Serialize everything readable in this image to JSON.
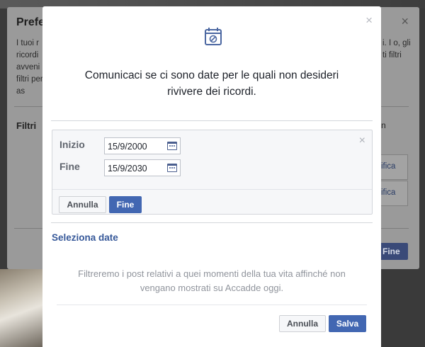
{
  "background_dialog": {
    "title": "Prefe",
    "text_left": "I tuoi r ricordi avveni filtri per as",
    "text_right": "i. I o, gli ti filtri",
    "filters_label": "Filtri",
    "right_label": "n",
    "edit_label_1": "ifica",
    "edit_label_2": "ifica",
    "done_button": "Fine"
  },
  "modal": {
    "icon": "calendar-block-icon",
    "heading": "Comunicaci se ci sono date per le quali non desideri rivivere dei ricordi.",
    "date_panel": {
      "start_label": "Inizio",
      "start_value": "15/9/2000",
      "end_label": "Fine",
      "end_value": "15/9/2030",
      "cancel_label": "Annulla",
      "done_label": "Fine"
    },
    "select_dates_label": "Seleziona date",
    "info_text": "Filtreremo i post relativi a quei momenti della tua vita affinché non vengano mostrati su Accadde oggi.",
    "cancel_button": "Annulla",
    "save_button": "Salva"
  },
  "colors": {
    "accent": "#4267b2",
    "link": "#365899",
    "overlay": "#3a3a3a"
  }
}
